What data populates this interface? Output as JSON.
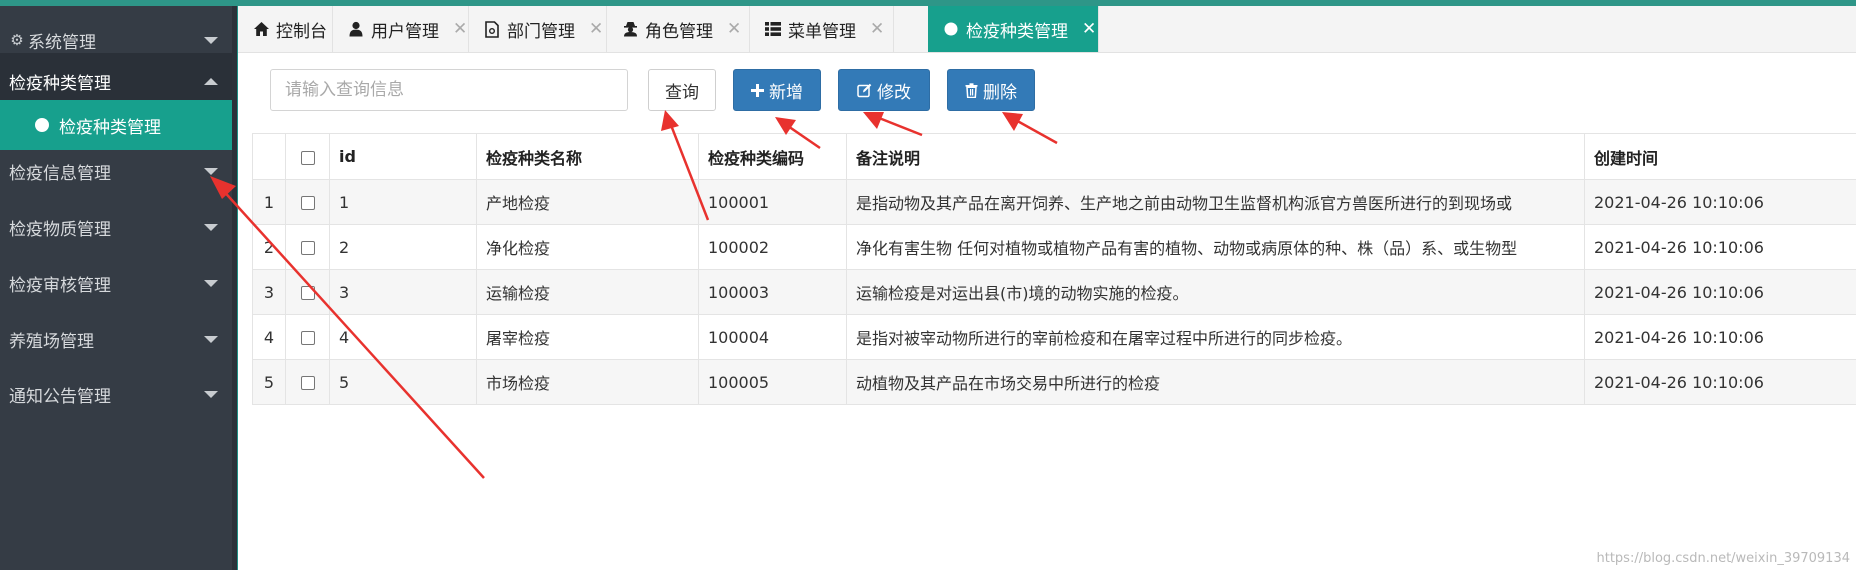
{
  "sidebar": {
    "items": [
      {
        "label": "系统管理",
        "icon": "gear-icon",
        "state": "collapsed"
      },
      {
        "label": "检疫种类管理",
        "state": "expanded"
      },
      {
        "label": "检疫种类管理",
        "state": "active-subitem"
      },
      {
        "label": "检疫信息管理",
        "state": "collapsed"
      },
      {
        "label": "检疫物质管理",
        "state": "collapsed"
      },
      {
        "label": "检疫审核管理",
        "state": "collapsed"
      },
      {
        "label": "养殖场管理",
        "state": "collapsed"
      },
      {
        "label": "通知公告管理",
        "state": "collapsed"
      }
    ]
  },
  "tabs": [
    {
      "label": "控制台",
      "icon": "home-icon",
      "closable": false
    },
    {
      "label": "用户管理",
      "icon": "user-icon",
      "closable": true
    },
    {
      "label": "部门管理",
      "icon": "document-icon",
      "closable": true
    },
    {
      "label": "角色管理",
      "icon": "user-secret-icon",
      "closable": true
    },
    {
      "label": "菜单管理",
      "icon": "list-icon",
      "closable": true
    },
    {
      "label": "检疫种类管理",
      "icon": "circle-icon",
      "closable": true,
      "active": true
    }
  ],
  "tab_close_glyph": "✕",
  "toolbar": {
    "search_placeholder": "请输入查询信息",
    "query_label": "查询",
    "add_label": "新增",
    "edit_label": "修改",
    "delete_label": "删除"
  },
  "table": {
    "headers": [
      "id",
      "检疫种类名称",
      "检疫种类编码",
      "备注说明",
      "创建时间"
    ],
    "rows": [
      {
        "n": "1",
        "id": "1",
        "name": "产地检疫",
        "code": "100001",
        "note": "是指动物及其产品在离开饲养、生产地之前由动物卫生监督机构派官方兽医所进行的到现场或",
        "created": "2021-04-26 10:10:06"
      },
      {
        "n": "2",
        "id": "2",
        "name": "净化检疫",
        "code": "100002",
        "note": "净化有害生物 任何对植物或植物产品有害的植物、动物或病原体的种、株（品）系、或生物型",
        "created": "2021-04-26 10:10:06"
      },
      {
        "n": "3",
        "id": "3",
        "name": "运输检疫",
        "code": "100003",
        "note": "运输检疫是对运出县(市)境的动物实施的检疫。",
        "created": "2021-04-26 10:10:06"
      },
      {
        "n": "4",
        "id": "4",
        "name": "屠宰检疫",
        "code": "100004",
        "note": "是指对被宰动物所进行的宰前检疫和在屠宰过程中所进行的同步检疫。",
        "created": "2021-04-26 10:10:06"
      },
      {
        "n": "5",
        "id": "5",
        "name": "市场检疫",
        "code": "100005",
        "note": "动植物及其产品在市场交易中所进行的检疫",
        "created": "2021-04-26 10:10:06"
      }
    ]
  },
  "watermark": "https://blog.csdn.net/weixin_39709134",
  "colors": {
    "accent": "#17a08d",
    "sidebar": "#353c45",
    "primary_button": "#337ab7",
    "annotation_arrow": "#e8322e"
  }
}
